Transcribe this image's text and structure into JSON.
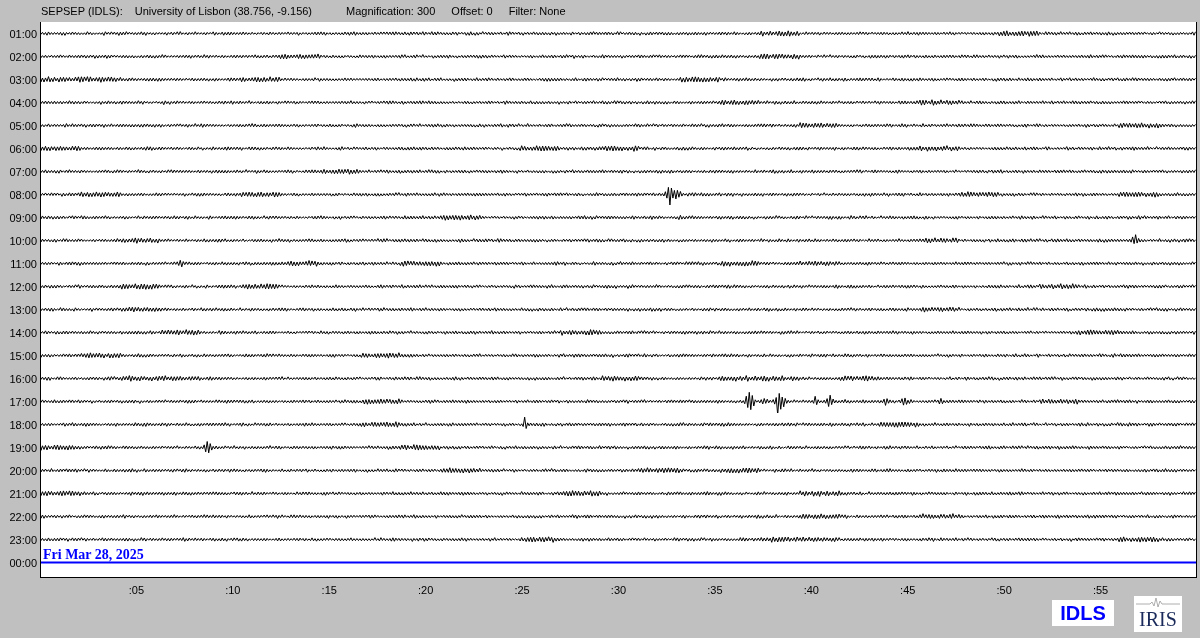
{
  "header": {
    "station": "SEPSEP (IDLS):",
    "location": "University of Lisbon (38.756, -9.156)",
    "magnification": "Magnification: 300",
    "offset": "Offset: 0",
    "filter": "Filter: None"
  },
  "hours": [
    {
      "label": "01:00",
      "current": false
    },
    {
      "label": "02:00",
      "current": false
    },
    {
      "label": "03:00",
      "current": false
    },
    {
      "label": "04:00",
      "current": false
    },
    {
      "label": "05:00",
      "current": false
    },
    {
      "label": "06:00",
      "current": false
    },
    {
      "label": "07:00",
      "current": false
    },
    {
      "label": "08:00",
      "current": false
    },
    {
      "label": "09:00",
      "current": false
    },
    {
      "label": "10:00",
      "current": false
    },
    {
      "label": "11:00",
      "current": false
    },
    {
      "label": "12:00",
      "current": false
    },
    {
      "label": "13:00",
      "current": false
    },
    {
      "label": "14:00",
      "current": false
    },
    {
      "label": "15:00",
      "current": false
    },
    {
      "label": "16:00",
      "current": false
    },
    {
      "label": "17:00",
      "current": false
    },
    {
      "label": "18:00",
      "current": false
    },
    {
      "label": "19:00",
      "current": false
    },
    {
      "label": "20:00",
      "current": false
    },
    {
      "label": "21:00",
      "current": false
    },
    {
      "label": "22:00",
      "current": false
    },
    {
      "label": "23:00",
      "current": false
    },
    {
      "label": "00:00",
      "current": true
    }
  ],
  "date_label": "Fri Mar 28, 2025",
  "x_axis": {
    "ticks": [
      ":05",
      ":10",
      ":15",
      ":20",
      ":25",
      ":30",
      ":35",
      ":40",
      ":45",
      ":50",
      ":55"
    ]
  },
  "logos": {
    "idls": "IDLS",
    "iris": "IRIS"
  }
}
